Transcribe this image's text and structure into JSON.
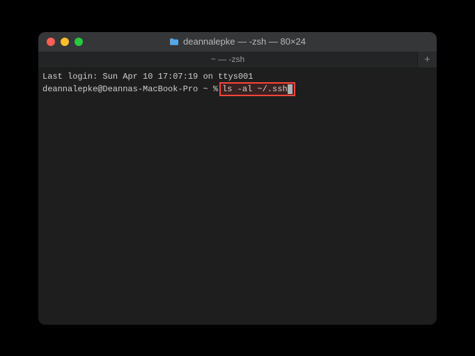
{
  "window": {
    "title": "deannalepke — -zsh — 80×24",
    "folder_icon": "folder-icon"
  },
  "tabs": {
    "active_label": "~ — -zsh",
    "new_tab_glyph": "+"
  },
  "terminal": {
    "last_login_line": "Last login: Sun Apr 10 17:07:19 on ttys001",
    "prompt": "deannalepke@Deannas-MacBook-Pro ~ %",
    "command": "ls -al ~/.ssh"
  },
  "colors": {
    "highlight_border": "#ff453a"
  }
}
